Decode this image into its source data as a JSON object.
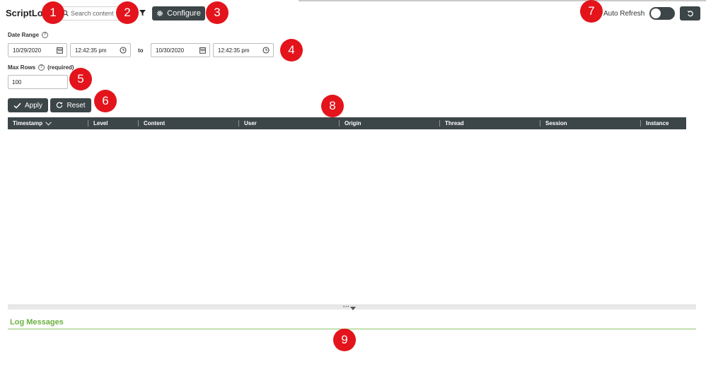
{
  "app": {
    "title": "ScriptLog"
  },
  "search": {
    "placeholder": "Search content",
    "value": ""
  },
  "toolbar": {
    "configure_label": "Configure",
    "auto_refresh_label": "Auto Refresh",
    "auto_refresh_on": false
  },
  "date_range": {
    "label": "Date Range",
    "from_date": "10/29/2020",
    "from_time": "12:42:35 pm",
    "to_label": "to",
    "to_date": "10/30/2020",
    "to_time": "12:42:35 pm"
  },
  "max_rows": {
    "label": "Max Rows",
    "required_text": "(required)",
    "value": "100"
  },
  "actions": {
    "apply_label": "Apply",
    "reset_label": "Reset"
  },
  "grid": {
    "columns": [
      "Timestamp",
      "Level",
      "Content",
      "User",
      "Origin",
      "Thread",
      "Session",
      "Instance"
    ],
    "rows": []
  },
  "log_panel": {
    "title": "Log Messages"
  },
  "annotations": [
    "1",
    "2",
    "3",
    "4",
    "5",
    "6",
    "7",
    "8",
    "9"
  ],
  "colors": {
    "dark": "#3c4548",
    "accent_green": "#6bb23f",
    "badge_red": "#e3141b"
  },
  "icons": [
    "search-icon",
    "filter-icon",
    "gear-icon",
    "calendar-icon",
    "clock-icon",
    "info-icon",
    "check-icon",
    "reset-icon",
    "undo-icon",
    "chevron-down-icon",
    "caret-down-icon"
  ]
}
